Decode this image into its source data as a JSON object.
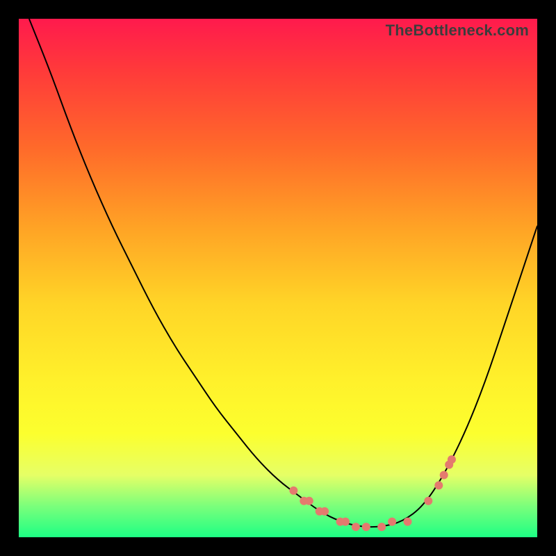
{
  "watermark": "TheBottleneck.com",
  "chart_data": {
    "type": "line",
    "title": "",
    "xlabel": "",
    "ylabel": "",
    "xlim": [
      0,
      100
    ],
    "ylim": [
      0,
      100
    ],
    "grid": false,
    "legend": false,
    "colors": {
      "curve": "#000000",
      "markers": "#e47a6e",
      "gradient_top": "#ff1a4d",
      "gradient_bottom": "#1dff84"
    },
    "series": [
      {
        "name": "bottleneck-curve",
        "x": [
          2,
          6,
          10,
          14,
          18,
          22,
          26,
          30,
          34,
          38,
          42,
          46,
          50,
          54,
          58,
          62,
          66,
          70,
          74,
          78,
          82,
          86,
          90,
          94,
          98,
          100
        ],
        "y": [
          100,
          90,
          79,
          69,
          60,
          52,
          44,
          37,
          31,
          25,
          20,
          15,
          11,
          8,
          5,
          3,
          2,
          2,
          3,
          6,
          12,
          20,
          30,
          42,
          54,
          60
        ]
      }
    ],
    "markers": {
      "name": "highlight-points",
      "x": [
        53,
        55,
        56,
        58,
        59,
        62,
        63,
        65,
        67,
        70,
        72,
        75,
        79,
        81,
        82,
        83,
        83.5
      ],
      "y": [
        9,
        7,
        7,
        5,
        5,
        3,
        3,
        2,
        2,
        2,
        3,
        3,
        7,
        10,
        12,
        14,
        15
      ]
    }
  }
}
